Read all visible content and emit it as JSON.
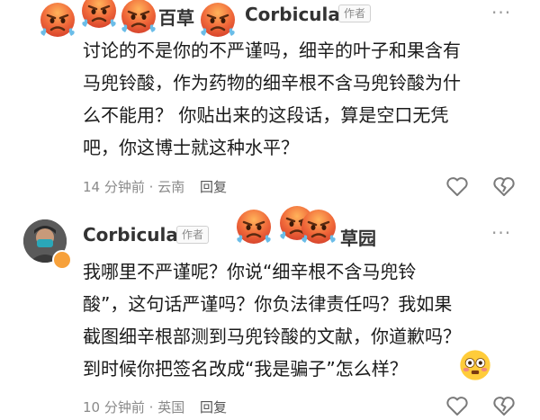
{
  "comment1": {
    "partial_name": "百草",
    "author": "Corbicula",
    "author_tag": "作者",
    "lines": [
      "讨论的不是你的不严谨吗，细辛的叶子和果含有",
      "马兜铃酸，作为药物的细辛根不含马兜铃酸为什",
      "么不能用？ 你贴出来的这段话，算是空口无凭",
      "吧，你这博士就这种水平？"
    ],
    "time": "14 分钟前",
    "location": "云南",
    "reply": "回复"
  },
  "comment2": {
    "author": "Corbicula",
    "author_tag": "作者",
    "partial_name": "草园",
    "lines": [
      "我哪里不严谨呢？你说“细辛根不含马兜铃",
      "酸”，这句话严谨吗？你负法律责任吗？我如果",
      "截图细辛根部测到马兜铃酸的文献，你道歉吗？",
      "到时候你把签名改成“我是骗子”怎么样？"
    ],
    "time": "10 分钟前",
    "location": "英国",
    "reply": "回复"
  },
  "icons": {
    "more": "more-dots-icon",
    "like": "heart-icon",
    "dislike": "broken-heart-icon",
    "angry": "angry-face-emoji",
    "flushed": "flushed-face-emoji"
  },
  "colors": {
    "text": "#1a1a1a",
    "meta": "#8a8a8a",
    "angry": "#e8553a"
  }
}
